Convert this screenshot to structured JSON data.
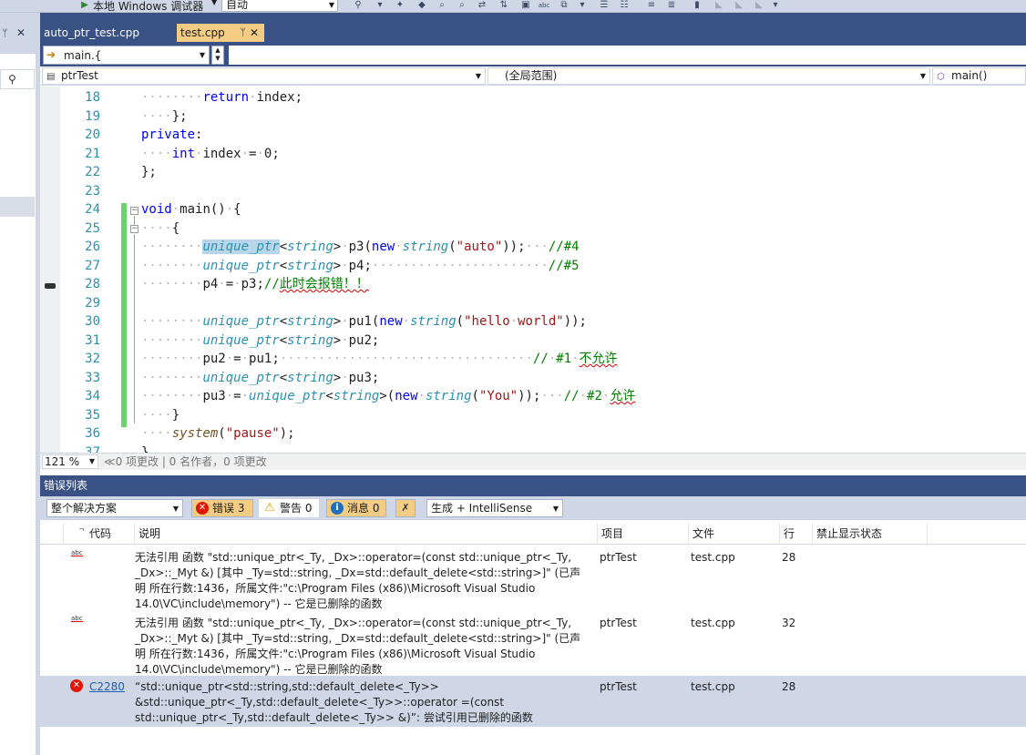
{
  "toolbar": {
    "debugger_label": "本地 Windows 调试器",
    "config_value": "自动"
  },
  "tabs": [
    {
      "label": "auto_ptr_test.cpp",
      "active": false
    },
    {
      "label": "test.cpp",
      "active": true
    }
  ],
  "find": {
    "value": "main.{"
  },
  "nav": {
    "project": "ptrTest",
    "scope": "(全局范围)",
    "member": "main()"
  },
  "editor": {
    "lines": [
      {
        "n": "18",
        "text": "········return·index;"
      },
      {
        "n": "19",
        "text": "····};"
      },
      {
        "n": "20",
        "text": "private:"
      },
      {
        "n": "21",
        "text": "····int·index·=·0;"
      },
      {
        "n": "22",
        "text": "};"
      },
      {
        "n": "23",
        "text": ""
      },
      {
        "n": "24",
        "text": "void·main()·{"
      },
      {
        "n": "25",
        "text": "····{"
      },
      {
        "n": "26",
        "text": "········unique_ptr<string>·p3(new·string(\"auto\"));···//#4"
      },
      {
        "n": "27",
        "text": "········unique_ptr<string>·p4;·······················//#5"
      },
      {
        "n": "28",
        "text": "········p4·=·p3;//此时会报错！！"
      },
      {
        "n": "29",
        "text": ""
      },
      {
        "n": "30",
        "text": "········unique_ptr<string>·pu1(new·string(\"hello·world\"));"
      },
      {
        "n": "31",
        "text": "········unique_ptr<string>·pu2;"
      },
      {
        "n": "32",
        "text": "········pu2·=·pu1;·································//·#1·不允许"
      },
      {
        "n": "33",
        "text": "········unique_ptr<string>·pu3;"
      },
      {
        "n": "34",
        "text": "········pu3·=·unique_ptr<string>(new·string(\"You\"));···//·#2·允许"
      },
      {
        "n": "35",
        "text": "····}"
      },
      {
        "n": "36",
        "text": "····system(\"pause\");"
      },
      {
        "n": "37",
        "text": "}"
      }
    ]
  },
  "status": {
    "zoom": "121 %",
    "codelens": "0 项更改 | 0 名作者，0 项更改"
  },
  "errors": {
    "title": "错误列表",
    "scope": "整个解决方案",
    "errors_btn": "错误 3",
    "warnings_btn": "警告 0",
    "messages_btn": "消息 0",
    "source": "生成 + IntelliSense",
    "columns": {
      "code": "代码",
      "desc": "说明",
      "project": "项目",
      "file": "文件",
      "line": "行",
      "suppress": "禁止显示状态"
    },
    "rows": [
      {
        "code": "",
        "icon": "spell-check-icon",
        "desc": "无法引用 函数 \"std::unique_ptr<_Ty, _Dx>::operator=(const std::unique_ptr<_Ty, _Dx>::_Myt &) [其中 _Ty=std::string, _Dx=std::default_delete<std::string>]\" (已声明 所在行数:1436，所属文件:\"c:\\Program Files (x86)\\Microsoft Visual Studio 14.0\\VC\\include\\memory\") -- 它是已删除的函数",
        "project": "ptrTest",
        "file": "test.cpp",
        "line": "28"
      },
      {
        "code": "",
        "icon": "spell-check-icon",
        "desc": "无法引用 函数 \"std::unique_ptr<_Ty, _Dx>::operator=(const std::unique_ptr<_Ty, _Dx>::_Myt &) [其中 _Ty=std::string, _Dx=std::default_delete<std::string>]\" (已声明 所在行数:1436，所属文件:\"c:\\Program Files (x86)\\Microsoft Visual Studio 14.0\\VC\\include\\memory\") -- 它是已删除的函数",
        "project": "ptrTest",
        "file": "test.cpp",
        "line": "32"
      },
      {
        "code": "C2280",
        "icon": "error-icon",
        "desc": "“std::unique_ptr<std::string,std::default_delete<_Ty>> &std::unique_ptr<_Ty,std::default_delete<_Ty>>::operator =(const std::unique_ptr<_Ty,std::default_delete<_Ty>> &)”: 尝试引用已删除的函数",
        "project": "ptrTest",
        "file": "test.cpp",
        "line": "28"
      }
    ]
  },
  "colors": {
    "accent_dark": "#3a5185",
    "tab_active": "#f5cc84",
    "chrome": "#cfd6e5",
    "keyword": "#0000ff",
    "type": "#2b91af",
    "string": "#a31515",
    "comment": "#008000"
  }
}
